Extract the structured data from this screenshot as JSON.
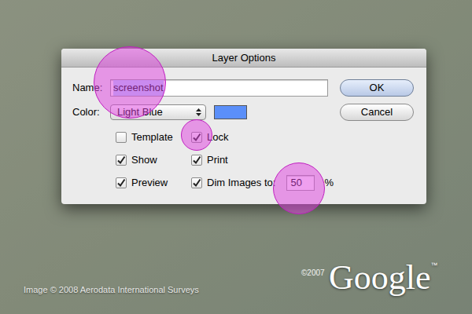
{
  "background": {
    "credit": "Image © 2008 Aerodata International Surveys",
    "copyright": "©2007",
    "logo": "Google",
    "logo_mark": "™"
  },
  "dialog": {
    "title": "Layer Options",
    "name": {
      "label": "Name:",
      "value": "screenshot",
      "selected": true
    },
    "color": {
      "label": "Color:",
      "value": "Light Blue",
      "swatch": "#5b8ff9"
    },
    "options": [
      {
        "label": "Template",
        "checked": false,
        "kind": "checkbox"
      },
      {
        "label": "Lock",
        "checked": true,
        "kind": "checkbox"
      },
      {
        "label": "Show",
        "checked": true,
        "kind": "checkbox"
      },
      {
        "label": "Print",
        "checked": true,
        "kind": "checkbox"
      },
      {
        "label": "Preview",
        "checked": true,
        "kind": "checkbox"
      },
      {
        "label": "Dim Images to:",
        "checked": true,
        "kind": "percent",
        "value": "50",
        "unit": "%"
      }
    ],
    "buttons": [
      {
        "label": "OK",
        "default": true
      },
      {
        "label": "Cancel",
        "default": false
      }
    ]
  }
}
